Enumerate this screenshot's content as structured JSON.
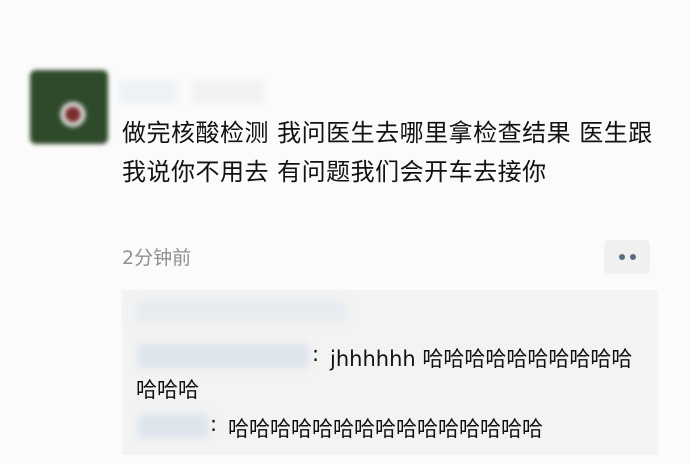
{
  "post": {
    "text": "做完核酸检测 我问医生去哪里拿检查结果 医生跟我说你不用去 有问题我们会开车去接你",
    "time": "2分钟前"
  },
  "comments": [
    {
      "separator": ":",
      "text": "jhhhhhh 哈哈哈哈哈哈哈哈哈哈哈哈哈"
    },
    {
      "separator": ":",
      "text": "哈哈哈哈哈哈哈哈哈哈哈哈哈哈哈"
    }
  ],
  "icons": {
    "more": "more-dots-icon"
  }
}
